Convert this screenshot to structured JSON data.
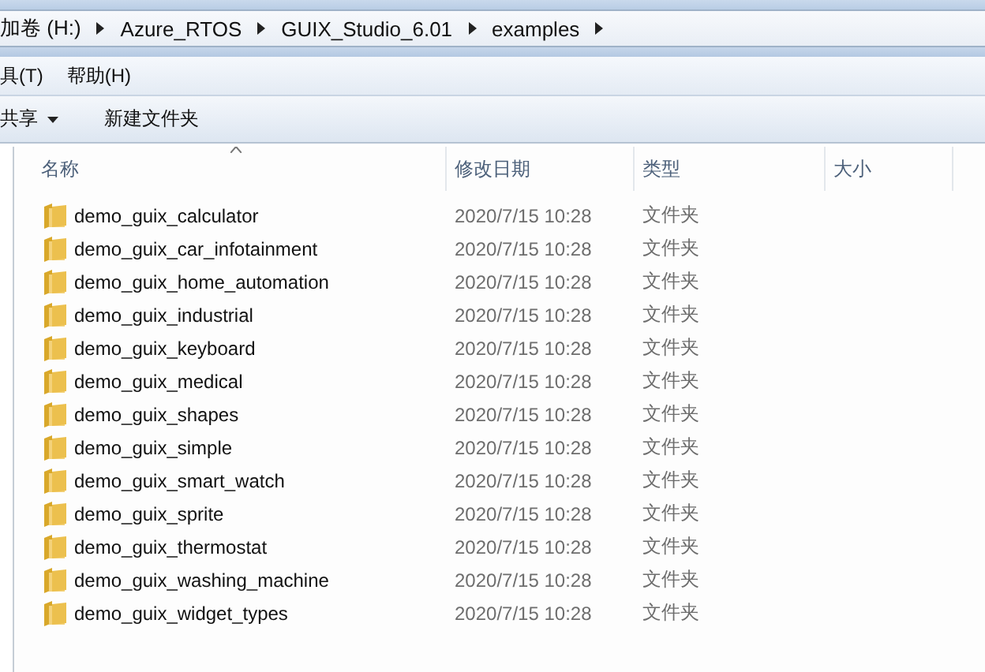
{
  "address_bar": {
    "segments": [
      "加卷 (H:)",
      "Azure_RTOS",
      "GUIX_Studio_6.01",
      "examples"
    ]
  },
  "menu_bar": [
    "具(T)",
    "帮助(H)"
  ],
  "toolbar": [
    {
      "label": "共享",
      "kind": "dropdown"
    },
    {
      "label": "新建文件夹",
      "kind": "button"
    }
  ],
  "table": {
    "columns": [
      {
        "label": "名称",
        "sorted": true
      },
      {
        "label": "修改日期",
        "sorted": false
      },
      {
        "label": "类型",
        "sorted": false
      },
      {
        "label": "大小",
        "sorted": false
      }
    ],
    "rows": [
      {
        "name": "demo_guix_calculator",
        "modified": "2020/7/15 10:28",
        "type": "文件夹"
      },
      {
        "name": "demo_guix_car_infotainment",
        "modified": "2020/7/15 10:28",
        "type": "文件夹"
      },
      {
        "name": "demo_guix_home_automation",
        "modified": "2020/7/15 10:28",
        "type": "文件夹"
      },
      {
        "name": "demo_guix_industrial",
        "modified": "2020/7/15 10:28",
        "type": "文件夹"
      },
      {
        "name": "demo_guix_keyboard",
        "modified": "2020/7/15 10:28",
        "type": "文件夹"
      },
      {
        "name": "demo_guix_medical",
        "modified": "2020/7/15 10:28",
        "type": "文件夹"
      },
      {
        "name": "demo_guix_shapes",
        "modified": "2020/7/15 10:28",
        "type": "文件夹"
      },
      {
        "name": "demo_guix_simple",
        "modified": "2020/7/15 10:28",
        "type": "文件夹"
      },
      {
        "name": "demo_guix_smart_watch",
        "modified": "2020/7/15 10:28",
        "type": "文件夹"
      },
      {
        "name": "demo_guix_sprite",
        "modified": "2020/7/15 10:28",
        "type": "文件夹"
      },
      {
        "name": "demo_guix_thermostat",
        "modified": "2020/7/15 10:28",
        "type": "文件夹"
      },
      {
        "name": "demo_guix_washing_machine",
        "modified": "2020/7/15 10:28",
        "type": "文件夹"
      },
      {
        "name": "demo_guix_widget_types",
        "modified": "2020/7/15 10:28",
        "type": "文件夹"
      }
    ]
  }
}
